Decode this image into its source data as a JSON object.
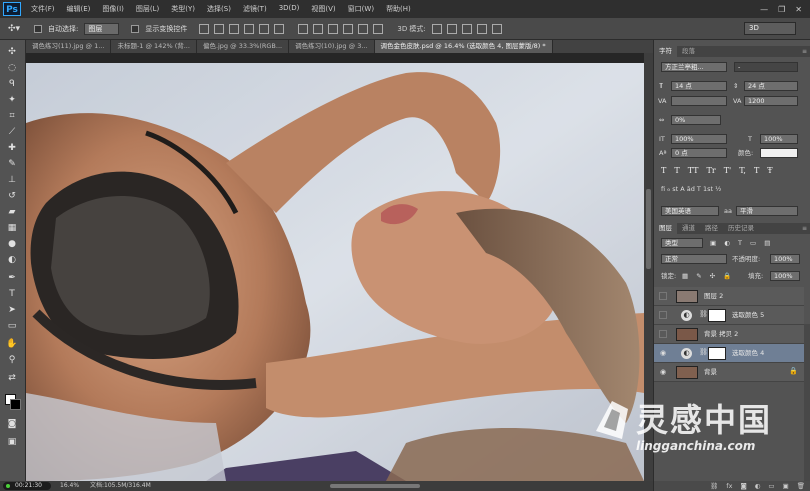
{
  "app": {
    "logo": "Ps"
  },
  "menubar": {
    "items": [
      "文件(F)",
      "编辑(E)",
      "图像(I)",
      "图层(L)",
      "类型(Y)",
      "选择(S)",
      "滤镜(T)",
      "3D(D)",
      "视图(V)",
      "窗口(W)",
      "帮助(H)"
    ],
    "window_controls": [
      "—",
      "❐",
      "✕"
    ]
  },
  "options": {
    "auto_select_label": "自动选择:",
    "auto_select_value": "图层",
    "show_transform_label": "显示变换控件",
    "mode3d_label": "3D 模式:",
    "workspace": "3D"
  },
  "tabs": [
    {
      "label": "调色练习(11).jpg @ 1...",
      "active": false
    },
    {
      "label": "未标题-1 @ 142% (背...",
      "active": false
    },
    {
      "label": "偏色.jpg @ 33.3%(RGB...",
      "active": false
    },
    {
      "label": "调色练习(10).jpg @ 3...",
      "active": false
    },
    {
      "label": "调色金色皮肤.psd @ 16.4% (选取颜色 4, 图层蒙版/8) *",
      "active": true
    }
  ],
  "status": {
    "timer": "00:21:30",
    "zoom": "16.4%",
    "doc_info": "文档:105.5M/316.4M"
  },
  "character_panel": {
    "tabs": [
      "字符",
      "段落"
    ],
    "font_family": "方正兰亭粗...",
    "font_style": "-",
    "font_size": "14 点",
    "leading": "24 点",
    "tracking": "1200",
    "scale_percent": "0%",
    "vertical_scale": "100%",
    "horizontal_scale": "100%",
    "baseline": "0 点",
    "color_label": "颜色:",
    "typo_buttons": [
      "T",
      "T",
      "TT",
      "Tr",
      "T'",
      "T,",
      "T",
      "Ŧ"
    ],
    "language": "美国英语",
    "antialias": "平滑",
    "aa_label": "aa"
  },
  "layers_panel": {
    "tabs": [
      "图层",
      "通道",
      "路径",
      "历史记录"
    ],
    "filter_kind": "类型",
    "blend_mode": "正常",
    "opacity_label": "不透明度:",
    "opacity": "100%",
    "lock_label": "锁定:",
    "fill_label": "填充:",
    "fill": "100%",
    "layers": [
      {
        "name": "图层 2",
        "visible": false,
        "selected": false,
        "kind": "pixel"
      },
      {
        "name": "选取颜色 5",
        "visible": false,
        "selected": false,
        "kind": "adjustment"
      },
      {
        "name": "背景 拷贝 2",
        "visible": false,
        "selected": false,
        "kind": "pixel"
      },
      {
        "name": "选取颜色 4",
        "visible": true,
        "selected": true,
        "kind": "adjustment"
      },
      {
        "name": "背景",
        "visible": true,
        "selected": false,
        "kind": "background",
        "locked": true
      }
    ],
    "footer_icons": [
      "link-icon",
      "fx-icon",
      "mask-icon",
      "adjustment-icon",
      "folder-icon",
      "new-layer-icon",
      "trash-icon"
    ]
  },
  "watermark": {
    "chinese": "灵感中国",
    "english": "lingganchina.com"
  },
  "colors": {
    "accent": "#31a8ff",
    "selected_layer": "#6f7f95"
  }
}
